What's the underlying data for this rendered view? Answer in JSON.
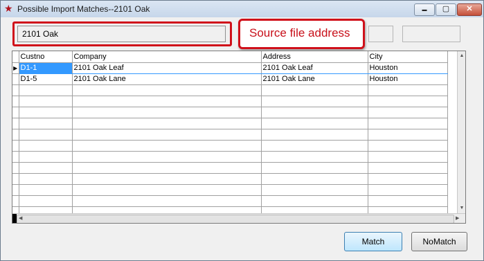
{
  "window": {
    "title": "Possible Import Matches--2101 Oak",
    "controls": {
      "minimize": "▬",
      "maximize": "▢",
      "close": "✕"
    }
  },
  "header": {
    "source_value": "2101 Oak",
    "callout_text": "Source file address",
    "highlight_color": "#d0101a"
  },
  "grid": {
    "columns": [
      "Custno",
      "Company",
      "Address",
      "City"
    ],
    "rows": [
      {
        "custno": "D1-1",
        "company": "2101 Oak Leaf",
        "address": "2101 Oak Leaf",
        "city": "Houston"
      },
      {
        "custno": "D1-5",
        "company": "2101 Oak Lane",
        "address": "2101 Oak Lane",
        "city": "Houston"
      }
    ],
    "selected_row": 0,
    "selection_color": "#3399ff"
  },
  "buttons": {
    "match": "Match",
    "nomatch": "NoMatch"
  }
}
